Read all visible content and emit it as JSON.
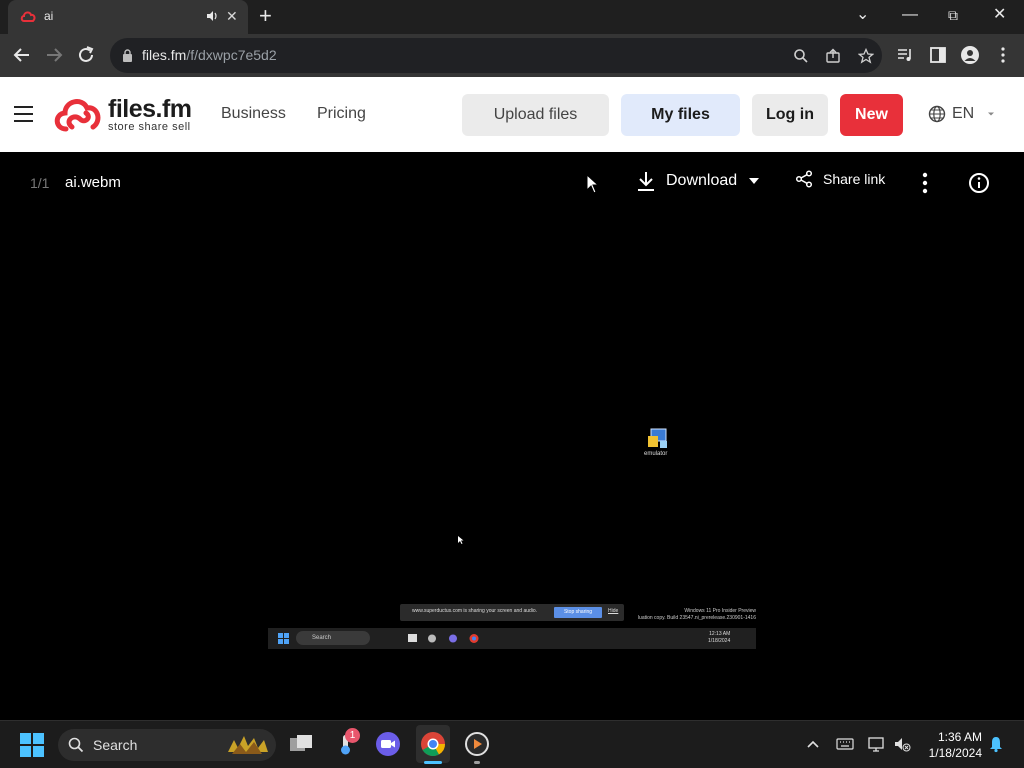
{
  "browser": {
    "tab": {
      "title": "ai",
      "favicon": "files-fm-cloud-icon",
      "audio_icon": "speaker-icon",
      "close": "✕"
    },
    "new_tab": "+",
    "window_controls": {
      "dropdown": "⌄",
      "minimize": "—",
      "restore": "⧉",
      "close": "✕"
    },
    "address": {
      "host": "files.fm",
      "path": "/f/dxwpc7e5d2"
    }
  },
  "site": {
    "logo": {
      "word": "files.fm",
      "tagline": "store share sell",
      "brand_color": "#e8303a"
    },
    "nav": [
      "Business",
      "Pricing"
    ],
    "buttons": {
      "upload": "Upload files",
      "my_files": "My files",
      "login": "Log in",
      "new": "New"
    },
    "language": "EN"
  },
  "viewer": {
    "counter": "1/1",
    "filename": "ai.webm",
    "download": "Download",
    "share": "Share link"
  },
  "video_frame": {
    "desktop_icon_label": "emulator",
    "share_bar_text": "www.superductus.com is sharing your screen and audio.",
    "stop_sharing": "Stop sharing",
    "hide": "Hide",
    "watermark_line1": "Windows 11 Pro Insider Preview",
    "watermark_line2": "luation copy. Build 23547.ni_prerelease.230901-1416",
    "search": "Search",
    "time": "12:13 AM",
    "date": "1/18/2024"
  },
  "taskbar": {
    "search": "Search",
    "badge": "1",
    "time": "1:36 AM",
    "date": "1/18/2024"
  }
}
